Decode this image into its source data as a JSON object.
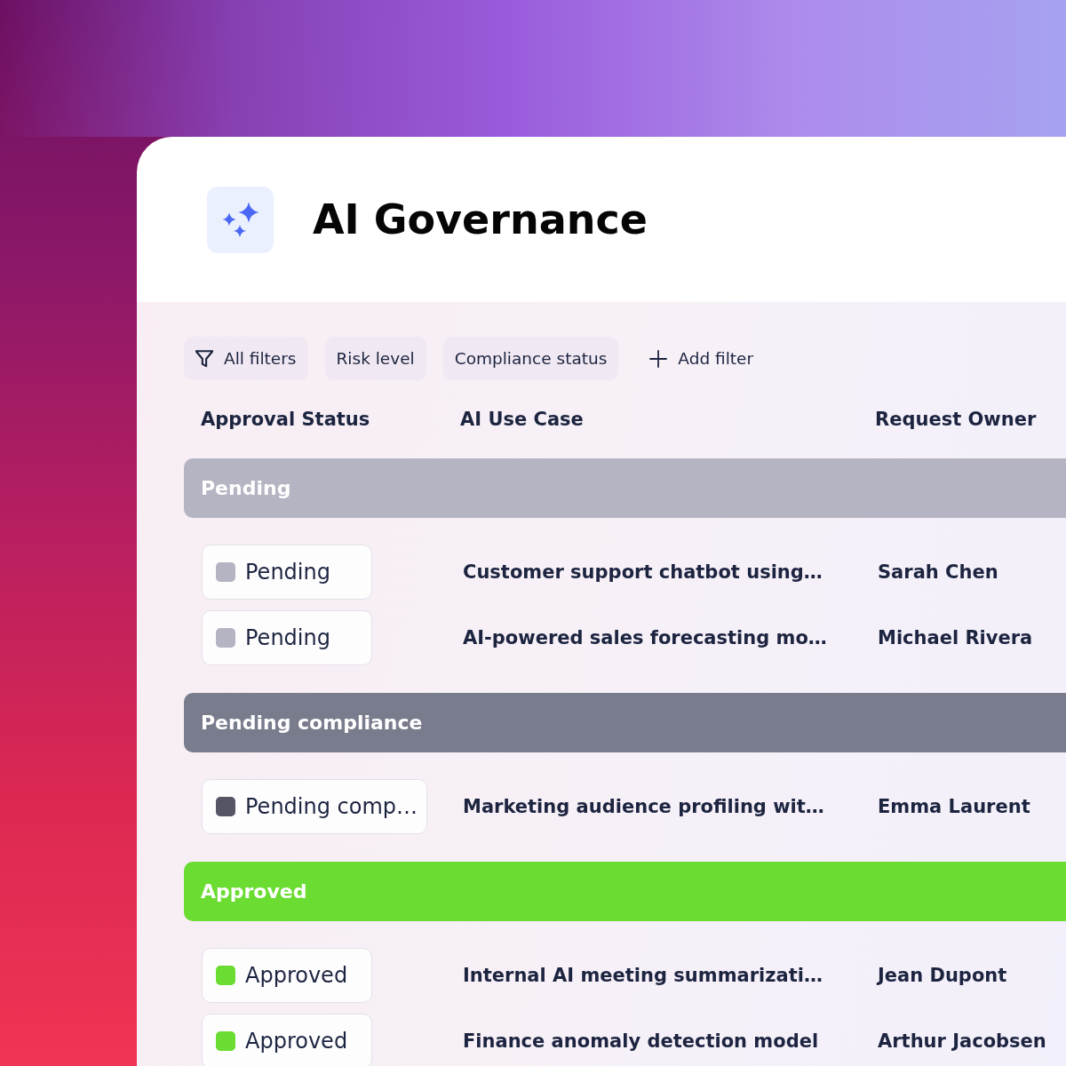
{
  "header": {
    "title": "AI Governance"
  },
  "filters": [
    {
      "label": "All filters",
      "kind": "all"
    },
    {
      "label": "Risk level",
      "kind": "chip"
    },
    {
      "label": "Compliance status",
      "kind": "chip"
    },
    {
      "label": "Add filter",
      "kind": "add"
    }
  ],
  "table": {
    "columns": [
      "Approval Status",
      "AI Use Case",
      "Request Owner"
    ],
    "groups": [
      {
        "label": "Pending",
        "color": "#b4b4c3",
        "rows": [
          {
            "status": "Pending",
            "color": "#b4b4c3",
            "use_case": "Customer support chatbot using…",
            "owner": "Sarah Chen"
          },
          {
            "status": "Pending",
            "color": "#b4b4c3",
            "use_case": "AI-powered sales forecasting mo…",
            "owner": "Michael Rivera"
          }
        ]
      },
      {
        "label": "Pending compliance",
        "color": "#797c8d",
        "rows": [
          {
            "status": "Pending comp…",
            "color": "#555566",
            "use_case": "Marketing audience profiling wit…",
            "owner": "Emma Laurent"
          }
        ]
      },
      {
        "label": "Approved",
        "color": "#6adc32",
        "rows": [
          {
            "status": "Approved",
            "color": "#6adc32",
            "use_case": "Internal AI meeting summarizati…",
            "owner": "Jean Dupont"
          },
          {
            "status": "Approved",
            "color": "#6adc32",
            "use_case": "Finance anomaly detection model",
            "owner": "Arthur Jacobsen"
          }
        ]
      }
    ]
  }
}
